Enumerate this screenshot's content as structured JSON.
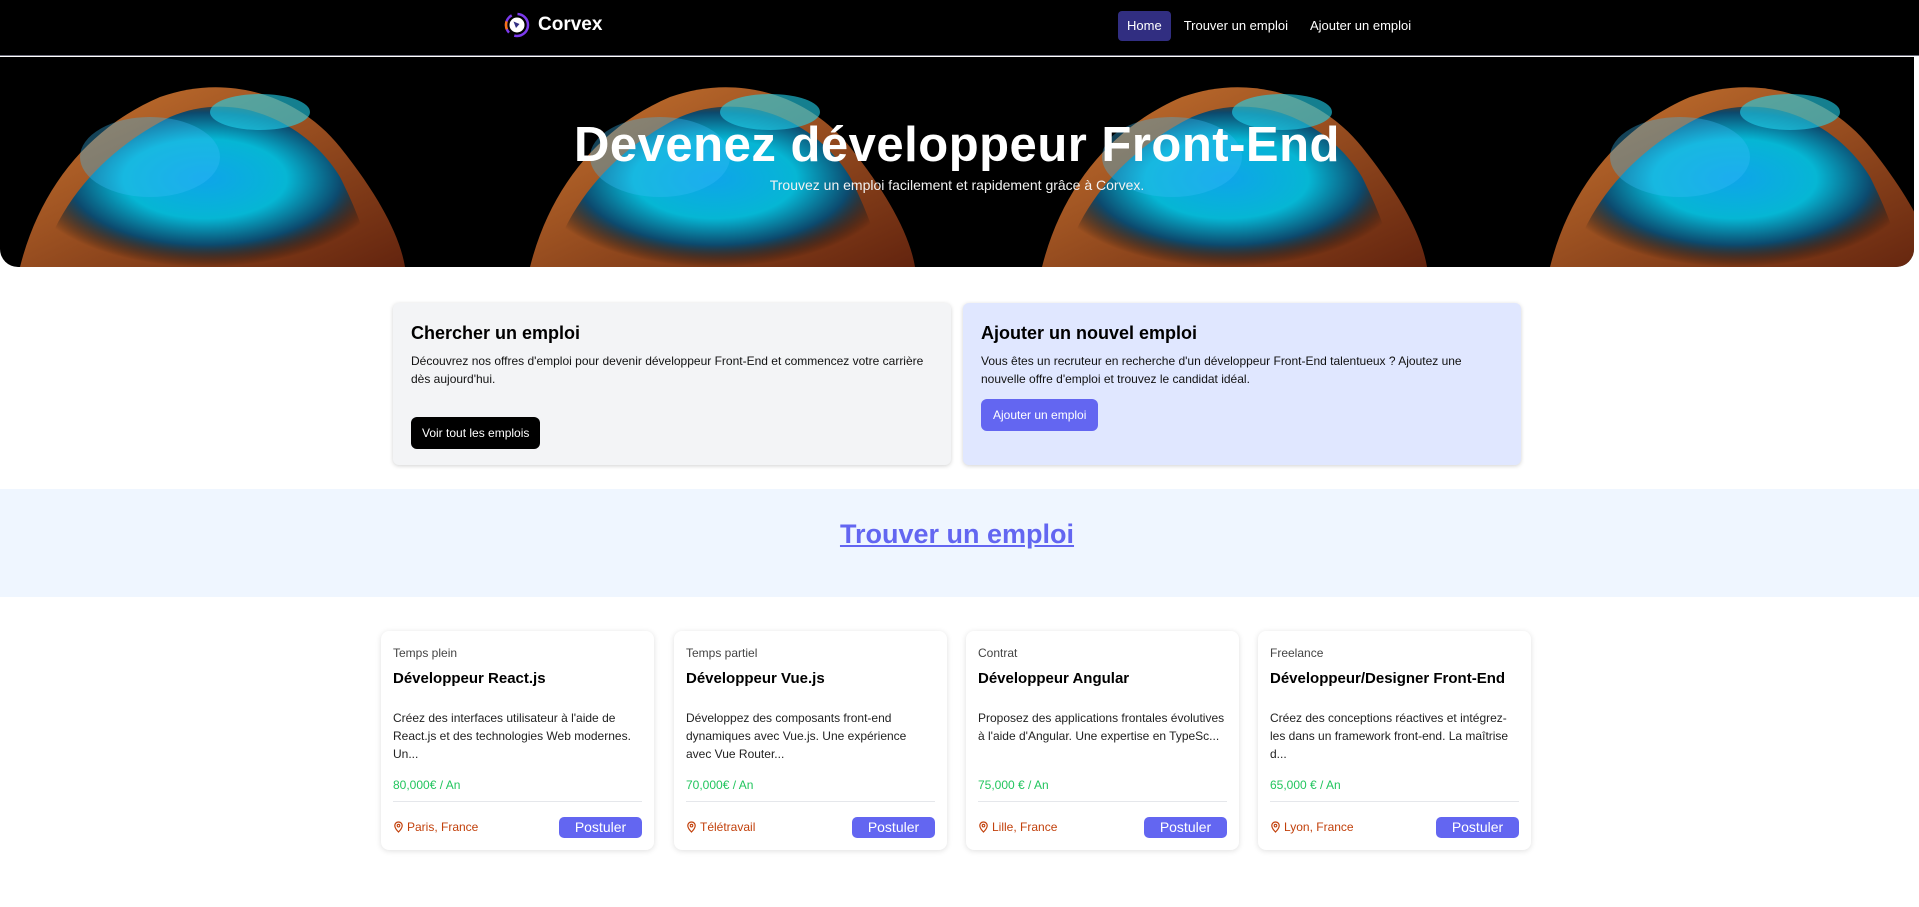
{
  "nav": {
    "brand": "Corvex",
    "links": [
      "Home",
      "Trouver un emploi",
      "Ajouter un emploi"
    ]
  },
  "hero": {
    "title": "Devenez développeur Front-End",
    "subtitle": "Trouvez un emploi facilement et rapidement grâce à Corvex."
  },
  "cta": {
    "search": {
      "title": "Chercher un emploi",
      "text": "Découvrez nos offres d'emploi pour devenir développeur Front-End et commencez votre carrière dès aujourd'hui.",
      "button": "Voir tout les emplois"
    },
    "add": {
      "title": "Ajouter un nouvel emploi",
      "text": "Vous êtes un recruteur en recherche d'un développeur Front-End talentueux ? Ajoutez une nouvelle offre d'emploi et trouvez le candidat idéal.",
      "button": "Ajouter un emploi"
    }
  },
  "band": {
    "title": "Trouver un emploi"
  },
  "jobs": [
    {
      "type": "Temps plein",
      "title": "Développeur React.js",
      "desc": "Créez des interfaces utilisateur à l'aide de React.js et des technologies Web modernes. Un...",
      "salary": "80,000€ / An",
      "location": "Paris, France",
      "apply": "Postuler"
    },
    {
      "type": "Temps partiel",
      "title": "Développeur Vue.js",
      "desc": "Développez des composants front-end dynamiques avec Vue.js. Une expérience avec Vue Router...",
      "salary": "70,000€ / An",
      "location": "Télétravail",
      "apply": "Postuler"
    },
    {
      "type": "Contrat",
      "title": "Développeur Angular",
      "desc": "Proposez des applications frontales évolutives à l'aide d'Angular. Une expertise en TypeSc...",
      "salary": "75,000 € / An",
      "location": "Lille, France",
      "apply": "Postuler"
    },
    {
      "type": "Freelance",
      "title": "Développeur/Designer Front-End",
      "desc": "Créez des conceptions réactives et intégrez-les dans un framework front-end. La maîtrise d...",
      "salary": "65,000 € / An",
      "location": "Lyon, France",
      "apply": "Postuler"
    }
  ],
  "colors": {
    "accent": "#6366f1",
    "nav_active": "#312e81",
    "salary": "#22c55e",
    "location": "#c2410c"
  },
  "icons": {
    "brand": "corvex-logo-icon",
    "location": "map-pin-icon"
  }
}
